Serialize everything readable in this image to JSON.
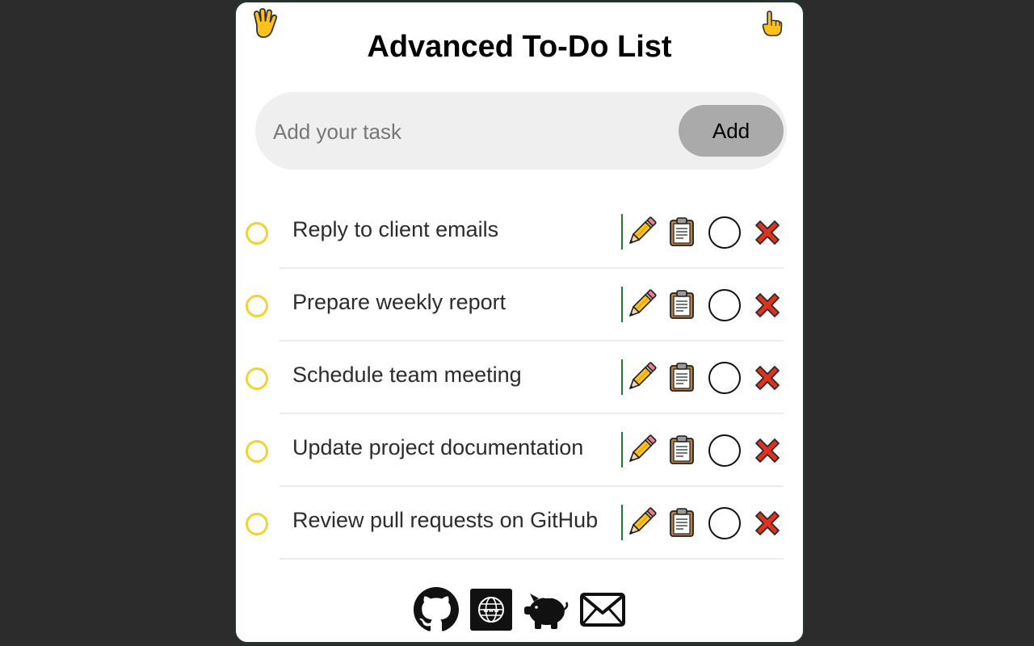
{
  "app": {
    "title": "Advanced To-Do List"
  },
  "header_icons": {
    "left": "raised-hand-icon",
    "right": "pointing-up-hand-icon"
  },
  "input": {
    "placeholder": "Add your task",
    "value": "",
    "add_label": "Add"
  },
  "tasks": [
    {
      "text": "Reply to client emails",
      "completed": false
    },
    {
      "text": "Prepare weekly report",
      "completed": false
    },
    {
      "text": "Schedule team meeting",
      "completed": false
    },
    {
      "text": "Update project documentation",
      "completed": false
    },
    {
      "text": "Review pull requests on GitHub",
      "completed": false
    }
  ],
  "task_actions": [
    "pencil-edit-icon",
    "clipboard-copy-icon",
    "status-circle-icon",
    "cross-delete-icon"
  ],
  "footer_icons": [
    "github-icon",
    "globe-website-icon",
    "piggy-bank-icon",
    "mail-icon"
  ],
  "colors": {
    "page_background": "#2b2c2b",
    "card_background": "#ffffff",
    "checkbox_ring": "#f2d232",
    "add_button": "#a9aaa9",
    "action_divider": "#1f7a34",
    "delete_red": "#e0301e"
  }
}
